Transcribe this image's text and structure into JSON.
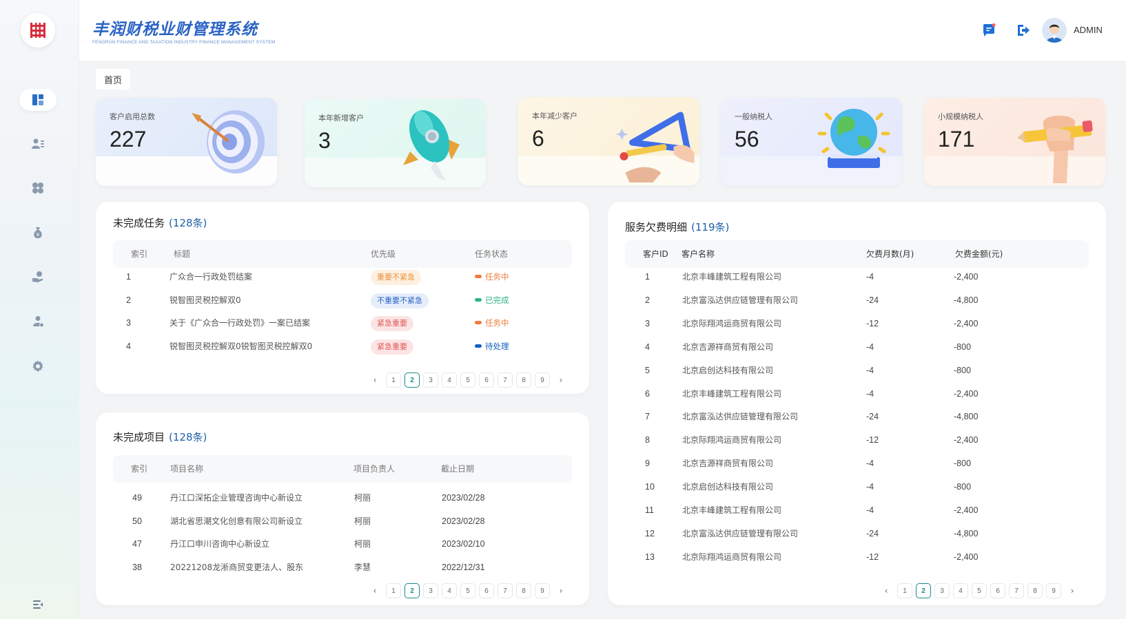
{
  "header": {
    "title": "丰润财税业财管理系统",
    "subtitle": "FENGRUN FINANCE AND TAXATION INDUSTRY FINANCE MANAGEMENT SYSTEM",
    "username": "ADMIN",
    "icons": [
      "message-icon",
      "logout-icon"
    ]
  },
  "sidebar": {
    "items": [
      {
        "name": "dashboard",
        "icon": "dashboard-icon",
        "active": true
      },
      {
        "name": "customers",
        "icon": "user-list-icon"
      },
      {
        "name": "apps",
        "icon": "apps-icon"
      },
      {
        "name": "finance",
        "icon": "money-bag-icon"
      },
      {
        "name": "services",
        "icon": "hand-coin-icon"
      },
      {
        "name": "staff",
        "icon": "team-icon"
      },
      {
        "name": "settings",
        "icon": "gear-icon"
      }
    ],
    "collapse_icon": "menu-collapse-icon"
  },
  "tag": {
    "label": "首页"
  },
  "stats": [
    {
      "label": "客户启用总数",
      "value": "227"
    },
    {
      "label": "本年新增客户",
      "value": "3"
    },
    {
      "label": "本年减少客户",
      "value": "6"
    },
    {
      "label": "一般纳税人",
      "value": "56"
    },
    {
      "label": "小规模纳税人",
      "value": "171"
    }
  ],
  "tasks": {
    "title": "未完成任务",
    "count": "(128条)",
    "columns": [
      "索引",
      "标题",
      "优先级",
      "任务状态"
    ],
    "rows": [
      {
        "idx": "1",
        "title": "广众合一行政处罚结案",
        "priority": "重要不紧急",
        "status": "任务中"
      },
      {
        "idx": "2",
        "title": "锐智图灵税控解双0",
        "priority": "不重要不紧急",
        "status": "已完成"
      },
      {
        "idx": "3",
        "title": "关于《广众合一行政处罚》一案已结案",
        "priority": "紧急重要",
        "status": "任务中"
      },
      {
        "idx": "4",
        "title": "锐智图灵税控解双0锐智图灵税控解双0",
        "priority": "紧急重要",
        "status": "待处理"
      }
    ],
    "pages": [
      "1",
      "2",
      "3",
      "4",
      "5",
      "6",
      "7",
      "8",
      "9"
    ],
    "current_page": "2"
  },
  "projects": {
    "title": "未完成项目",
    "count": "(128条)",
    "columns": [
      "索引",
      "项目名称",
      "项目负责人",
      "截止日期"
    ],
    "rows": [
      {
        "idx": "49",
        "name": "丹江口深拓企业管理咨询中心新设立",
        "owner": "柯丽",
        "date": "2023/02/28"
      },
      {
        "idx": "50",
        "name": "湖北省思潮文化创意有限公司新设立",
        "owner": "柯丽",
        "date": "2023/02/28"
      },
      {
        "idx": "47",
        "name": "丹江口申川咨询中心新设立",
        "owner": "柯丽",
        "date": "2023/02/10"
      },
      {
        "idx": "38",
        "name": "20221208龙淅商贸变更法人、股东",
        "owner": "李慧",
        "date": "2022/12/31"
      }
    ],
    "pages": [
      "1",
      "2",
      "3",
      "4",
      "5",
      "6",
      "7",
      "8",
      "9"
    ],
    "current_page": "2"
  },
  "arrears": {
    "title": "服务欠费明细",
    "count": "(119条)",
    "columns": [
      "客户ID",
      "客户名称",
      "欠费月数(月)",
      "欠费金额(元)"
    ],
    "rows": [
      {
        "id": "1",
        "name": "北京丰峰建筑工程有限公司",
        "months": "-4",
        "amount": "-2,400"
      },
      {
        "id": "2",
        "name": "北京富泓达供应链管理有限公司",
        "months": "-24",
        "amount": "-4,800"
      },
      {
        "id": "3",
        "name": "北京际翔鸿运商贸有限公司",
        "months": "-12",
        "amount": "-2,400"
      },
      {
        "id": "4",
        "name": "北京吉源祥商贸有限公司",
        "months": "-4",
        "amount": "-800"
      },
      {
        "id": "5",
        "name": "北京启创达科技有限公司",
        "months": "-4",
        "amount": "-800"
      },
      {
        "id": "6",
        "name": "北京丰峰建筑工程有限公司",
        "months": "-4",
        "amount": "-2,400"
      },
      {
        "id": "7",
        "name": "北京富泓达供应链管理有限公司",
        "months": "-24",
        "amount": "-4,800"
      },
      {
        "id": "8",
        "name": "北京际翔鸿运商贸有限公司",
        "months": "-12",
        "amount": "-2,400"
      },
      {
        "id": "9",
        "name": "北京吉源祥商贸有限公司",
        "months": "-4",
        "amount": "-800"
      },
      {
        "id": "10",
        "name": "北京启创达科技有限公司",
        "months": "-4",
        "amount": "-800"
      },
      {
        "id": "11",
        "name": "北京丰峰建筑工程有限公司",
        "months": "-4",
        "amount": "-2,400"
      },
      {
        "id": "12",
        "name": "北京富泓达供应链管理有限公司",
        "months": "-24",
        "amount": "-4,800"
      },
      {
        "id": "13",
        "name": "北京际翔鸿运商贸有限公司",
        "months": "-12",
        "amount": "-2,400"
      }
    ],
    "pages": [
      "1",
      "2",
      "3",
      "4",
      "5",
      "6",
      "7",
      "8",
      "9"
    ],
    "current_page": "2"
  },
  "colors": {
    "brand": "#2a63c4",
    "accent_teal": "#1a8a8a",
    "count_blue": "#1e5fa8",
    "status_in_progress": "#f07a3a",
    "status_done": "#2fb38a",
    "status_pending": "#1560c4"
  }
}
